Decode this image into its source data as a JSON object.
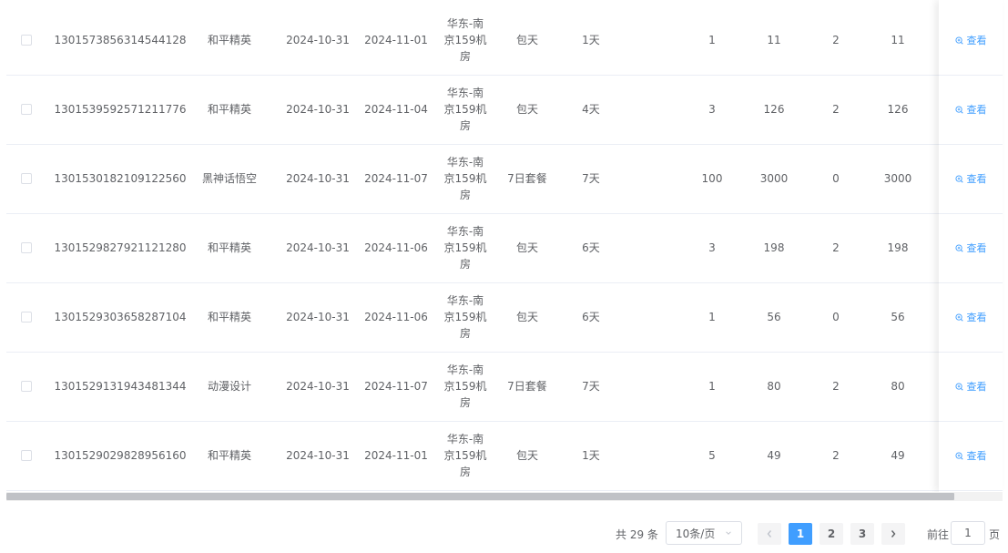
{
  "rows": [
    {
      "id": "1301573856314544128",
      "game": "和平精英",
      "start": "2024-10-31",
      "end": "2024-11-01",
      "room": [
        "华东-南",
        "京159机",
        "房"
      ],
      "package": "包天",
      "duration": "1天",
      "n1": "1",
      "n2": "11",
      "n3": "2",
      "n4": "11"
    },
    {
      "id": "1301539592571211776",
      "game": "和平精英",
      "start": "2024-10-31",
      "end": "2024-11-04",
      "room": [
        "华东-南",
        "京159机",
        "房"
      ],
      "package": "包天",
      "duration": "4天",
      "n1": "3",
      "n2": "126",
      "n3": "2",
      "n4": "126"
    },
    {
      "id": "1301530182109122560",
      "game": "黑神话悟空",
      "start": "2024-10-31",
      "end": "2024-11-07",
      "room": [
        "华东-南",
        "京159机",
        "房"
      ],
      "package": "7日套餐",
      "duration": "7天",
      "n1": "100",
      "n2": "3000",
      "n3": "0",
      "n4": "3000"
    },
    {
      "id": "1301529827921121280",
      "game": "和平精英",
      "start": "2024-10-31",
      "end": "2024-11-06",
      "room": [
        "华东-南",
        "京159机",
        "房"
      ],
      "package": "包天",
      "duration": "6天",
      "n1": "3",
      "n2": "198",
      "n3": "2",
      "n4": "198"
    },
    {
      "id": "1301529303658287104",
      "game": "和平精英",
      "start": "2024-10-31",
      "end": "2024-11-06",
      "room": [
        "华东-南",
        "京159机",
        "房"
      ],
      "package": "包天",
      "duration": "6天",
      "n1": "1",
      "n2": "56",
      "n3": "0",
      "n4": "56"
    },
    {
      "id": "1301529131943481344",
      "game": "动漫设计",
      "start": "2024-10-31",
      "end": "2024-11-07",
      "room": [
        "华东-南",
        "京159机",
        "房"
      ],
      "package": "7日套餐",
      "duration": "7天",
      "n1": "1",
      "n2": "80",
      "n3": "2",
      "n4": "80"
    },
    {
      "id": "1301529029828956160",
      "game": "和平精英",
      "start": "2024-10-31",
      "end": "2024-11-01",
      "room": [
        "华东-南",
        "京159机",
        "房"
      ],
      "package": "包天",
      "duration": "1天",
      "n1": "5",
      "n2": "49",
      "n3": "2",
      "n4": "49"
    }
  ],
  "action_label": "查看",
  "pagination": {
    "total_text": "共 29 条",
    "page_size": "10条/页",
    "pages": [
      "1",
      "2",
      "3"
    ],
    "current_page": "1",
    "goto_label": "前往",
    "goto_value": "1",
    "goto_suffix": "页"
  },
  "colors": {
    "accent": "#409eff",
    "border": "#ebeef5",
    "text": "#606266"
  }
}
